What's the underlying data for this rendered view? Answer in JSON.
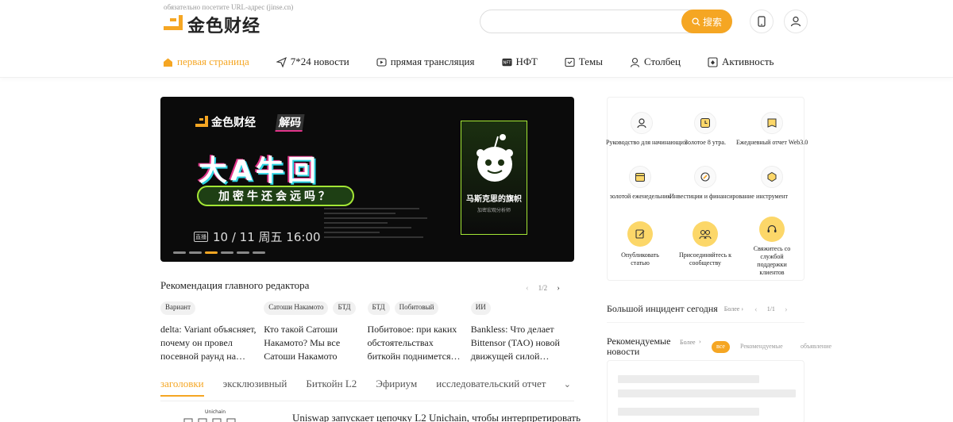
{
  "header": {
    "hint": "обязательно посетите URL-адрес (jinse.cn)",
    "logo_text": "金色财经",
    "search": {
      "placeholder": "",
      "button_label": "搜索"
    }
  },
  "nav": [
    {
      "label": "первая страница",
      "icon": "home-icon",
      "active": true
    },
    {
      "label": "7*24 новости",
      "icon": "send-icon"
    },
    {
      "label": "прямая трансляция",
      "icon": "live-icon"
    },
    {
      "label": "НФТ",
      "icon": "nft-icon"
    },
    {
      "label": "Темы",
      "icon": "topic-icon"
    },
    {
      "label": "Столбец",
      "icon": "column-icon"
    },
    {
      "label": "Активность",
      "icon": "activity-icon"
    }
  ],
  "banner": {
    "logo": "金色财经",
    "tag": "解码",
    "headline": "大A牛回",
    "subline": "加密牛还会远吗？",
    "date": "10 / 11 周五  16:00",
    "tv": "直播",
    "card_title": "马斯克思的旗帜",
    "card_sub": "加密宏观分析师",
    "dots_active": 2
  },
  "recommendations": {
    "title": "Рекомендация главного редактора",
    "page": "1/2",
    "items": [
      {
        "tags": [
          "Вариант"
        ],
        "text": "delta: Variant объясняет, почему он провел посевной раунд на…"
      },
      {
        "tags": [
          "Сатоши Накамото",
          "БТД"
        ],
        "text": "Кто такой Сатоши Накамото? Мы все Сатоши Накамото"
      },
      {
        "tags": [
          "БТД",
          "Побитовый"
        ],
        "text": "Побитовое: при каких обстоятельствах биткойн поднимется…"
      },
      {
        "tags": [
          "ИИ"
        ],
        "text": "Bankless: Что делает Bittensor (TAO) новой движущей силой…"
      }
    ]
  },
  "tabs": [
    "заголовки",
    "эксклюзивный",
    "Биткойн L2",
    "Эфириум",
    "исследовательский отчет"
  ],
  "news": {
    "headline": "Uniswap запускает цепочку L2 Unichain, чтобы интерпретировать",
    "thumb_label": "Unichain"
  },
  "services": [
    {
      "label": "Руководство для начинающих",
      "icon": "user-guide-icon"
    },
    {
      "label": "Золотое 8 утра.",
      "icon": "clock-icon"
    },
    {
      "label": "Ежедневный отчет Web3.0",
      "icon": "report-icon"
    },
    {
      "label": "золотой еженедельник",
      "icon": "calendar-icon"
    },
    {
      "label": "Инвестиции и финансирование",
      "icon": "investment-icon"
    },
    {
      "label": "инструмент",
      "icon": "tool-icon"
    },
    {
      "label": "Опубликовать статью",
      "icon": "edit-icon"
    },
    {
      "label": "Присоединяйтесь к сообществу",
      "icon": "community-icon"
    },
    {
      "label": "Свяжитесь со службой поддержки клиентов",
      "icon": "support-icon"
    }
  ],
  "incident": {
    "title": "Большой инцидент сегодня",
    "more": "Более",
    "page": "1/1"
  },
  "recommended": {
    "title": "Рекомендуемые новости",
    "more": "Более",
    "pills": [
      "все",
      "Рекомендуемые",
      "объявление"
    ]
  },
  "colors": {
    "accent": "#f5a623",
    "banner_green": "#a3e635"
  }
}
